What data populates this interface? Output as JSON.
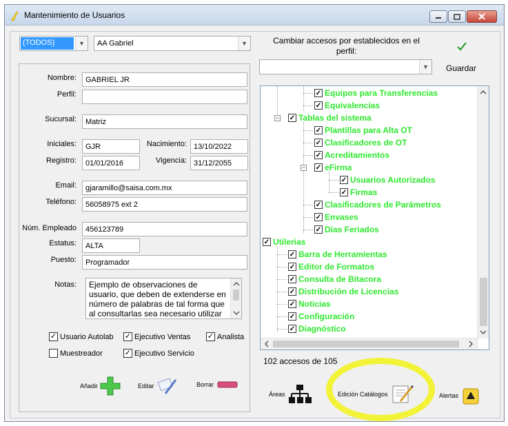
{
  "window": {
    "title": "Mantenimiento de Usuarios"
  },
  "top": {
    "filter_select": "(TODOS)",
    "user_select": "AA Gabriel",
    "profile_change_label": "Cambiar accesos por establecidos en el perfil:",
    "profile_select": "",
    "save_label": "Guardar"
  },
  "form": {
    "nombre_label": "Nombre:",
    "nombre": "GABRIEL JR",
    "perfil_label": "Perfil:",
    "perfil": "",
    "sucursal_label": "Sucursal:",
    "sucursal": "Matriz",
    "iniciales_label": "Iniciales:",
    "iniciales": "GJR",
    "nacimiento_label": "Nacimiento:",
    "nacimiento": "13/10/2022",
    "registro_label": "Registro:",
    "registro": "01/01/2016",
    "vigencia_label": "Vigencia:",
    "vigencia": "31/12/2055",
    "email_label": "Email:",
    "email": "gjaramillo@saisa.com.mx",
    "telefono_label": "Teléfono:",
    "telefono": "56058975 ext 2",
    "empleado_label": "Núm. Empleado",
    "empleado": "456123789",
    "estatus_label": "Estatus:",
    "estatus": "ALTA",
    "puesto_label": "Puesto:",
    "puesto": "Programador",
    "notas_label": "Notas:",
    "notas": "Ejemplo de observaciones de usuario, que deben de extenderse en número de palabras de tal forma que al consultarlas sea necesario utilizar las"
  },
  "checks": {
    "autolab": {
      "label": "Usuario Autolab",
      "checked": true
    },
    "ventas": {
      "label": "Ejecutivo Ventas",
      "checked": true
    },
    "analista": {
      "label": "Analista",
      "checked": true
    },
    "muestreador": {
      "label": "Muestreador",
      "checked": false
    },
    "servicio": {
      "label": "Ejecutivo Servicio",
      "checked": true
    }
  },
  "actions": {
    "add": "Añadir",
    "edit": "Editar",
    "delete": "Borrar"
  },
  "tree": {
    "nodes": [
      {
        "label": "Equipos para Transferencias",
        "checked": true
      },
      {
        "label": "Equivalencias",
        "checked": true
      },
      {
        "label": "Tablas del sistema",
        "checked": true
      },
      {
        "label": "Plantillas para Alta OT",
        "checked": true
      },
      {
        "label": "Clasificadores de OT",
        "checked": true
      },
      {
        "label": "Acreditamientos",
        "checked": true
      },
      {
        "label": "eFirma",
        "checked": true
      },
      {
        "label": "Usuarios Autorizados",
        "checked": true
      },
      {
        "label": "Firmas",
        "checked": true
      },
      {
        "label": "Clasificadores de Parámetros",
        "checked": true
      },
      {
        "label": "Envases",
        "checked": true
      },
      {
        "label": "Dias Feriados",
        "checked": true
      },
      {
        "label": "Utilerias",
        "checked": true
      },
      {
        "label": "Barra de Herramientas",
        "checked": true
      },
      {
        "label": "Editor de Formatos",
        "checked": true
      },
      {
        "label": "Consulta de Bitacora",
        "checked": true
      },
      {
        "label": "Distribución de Licencias",
        "checked": true
      },
      {
        "label": "Noticias",
        "checked": true
      },
      {
        "label": "Configuración",
        "checked": true
      },
      {
        "label": "Diagnóstico",
        "checked": true
      }
    ]
  },
  "access_count": "102 accesos de 105",
  "bottom": {
    "areas": "Áreas",
    "catalogs": "Edición Catálogos",
    "alerts": "Alertas"
  },
  "colors": {
    "tree_text": "#2ee82e",
    "highlight": "#f2f227",
    "selection": "#3399ff"
  },
  "icons": [
    "app-icon",
    "minimize-icon",
    "maximize-icon",
    "close-icon",
    "checkmark-icon",
    "add-icon",
    "edit-icon",
    "delete-icon",
    "org-chart-icon",
    "catalog-edit-icon",
    "alert-icon"
  ]
}
